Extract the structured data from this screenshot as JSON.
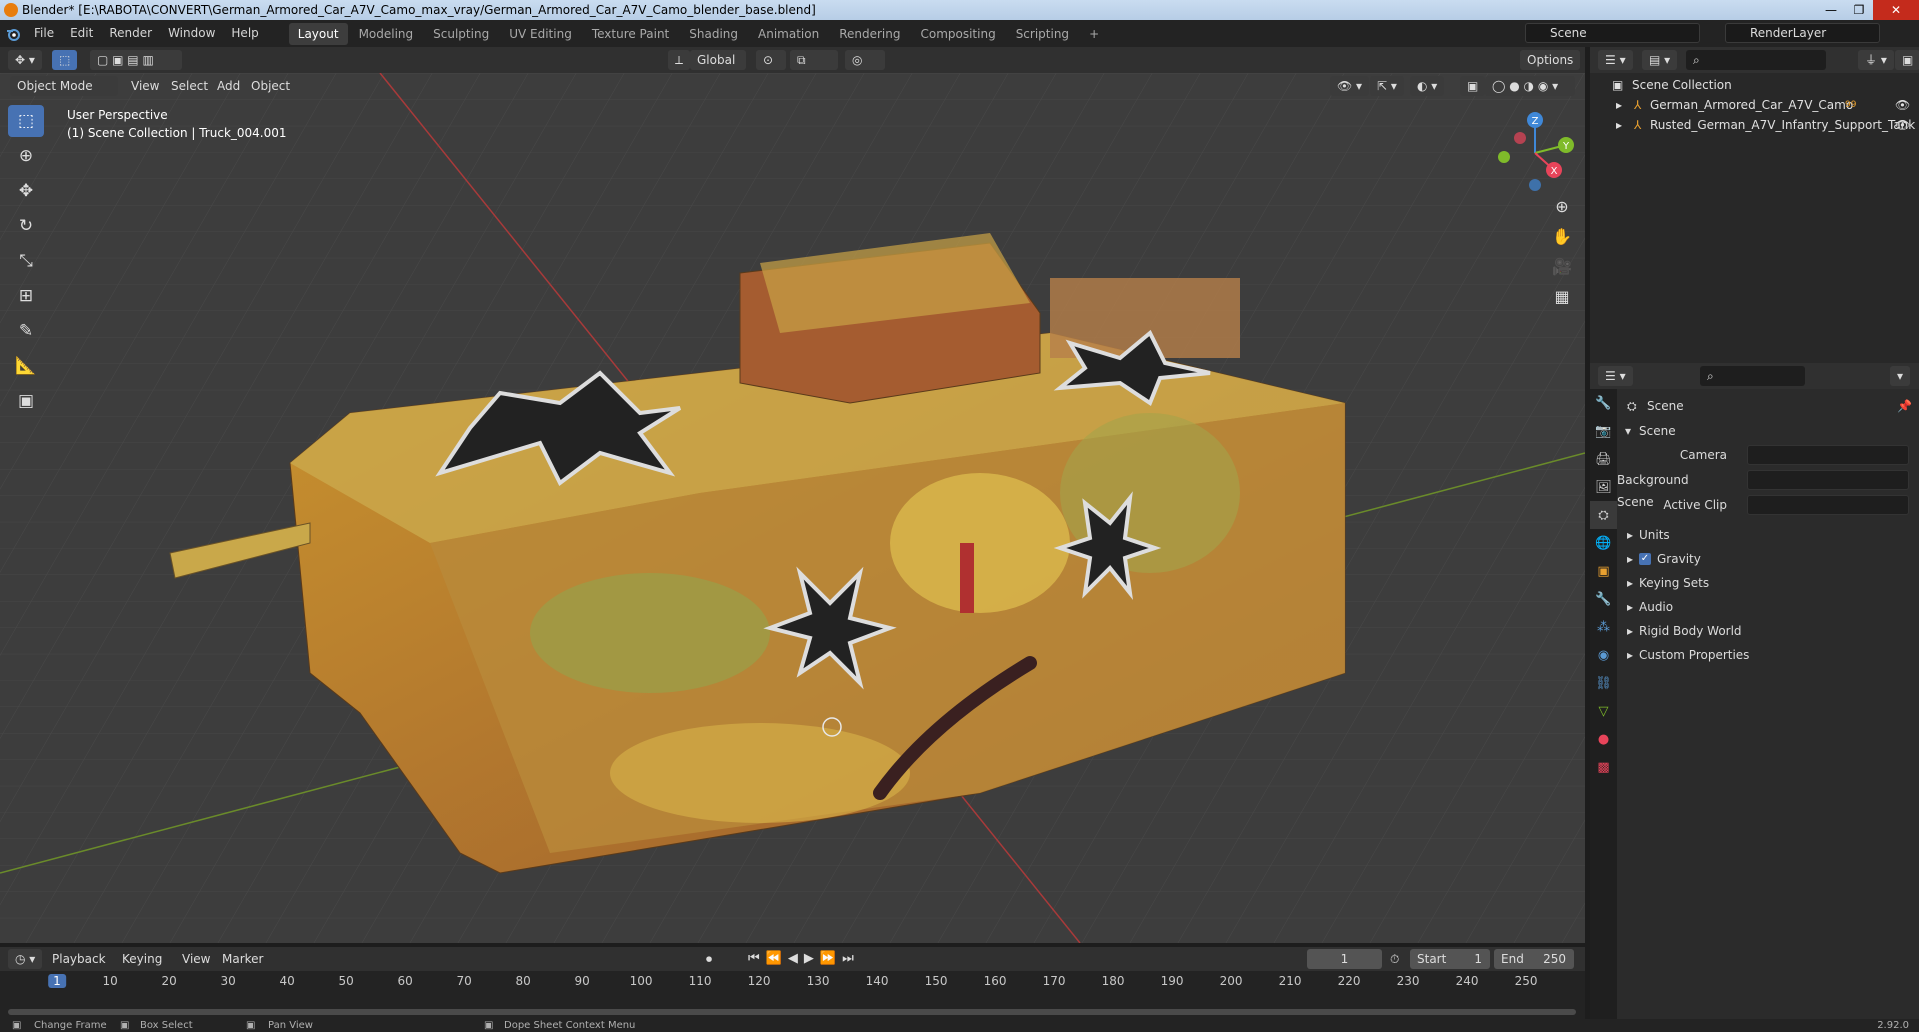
{
  "window": {
    "title": "Blender* [E:\\RABOTA\\CONVERT\\German_Armored_Car_A7V_Camo_max_vray/German_Armored_Car_A7V_Camo_blender_base.blend]",
    "controls": [
      "—",
      "❐",
      "✕"
    ]
  },
  "menu": [
    "File",
    "Edit",
    "Render",
    "Window",
    "Help"
  ],
  "workspaces": [
    "Layout",
    "Modeling",
    "Sculpting",
    "UV Editing",
    "Texture Paint",
    "Shading",
    "Animation",
    "Rendering",
    "Compositing",
    "Scripting"
  ],
  "workspace_add": "+",
  "scene_selector": "Scene",
  "view_layer": "RenderLayer",
  "viewport_header": {
    "transform_orientation": "Global",
    "options": "Options",
    "mode": "Object Mode",
    "menus": [
      "View",
      "Select",
      "Add",
      "Object"
    ]
  },
  "viewport": {
    "perspective": "User Perspective",
    "collection_info": "(1) Scene Collection | Truck_004.001",
    "gizmo": {
      "x": "X",
      "y": "Y",
      "z": "Z"
    },
    "colors": {
      "x_axis": "#e8445a",
      "y_axis": "#7fbb2a",
      "z_axis": "#3f88d8",
      "background": "#3d3d3d"
    }
  },
  "outliner": {
    "root": "Scene Collection",
    "items": [
      {
        "name": "German_Armored_Car_A7V_Camo",
        "badge": "99"
      },
      {
        "name": "Rusted_German_A7V_Infantry_Support_Tank",
        "badge": ""
      }
    ]
  },
  "properties": {
    "context": "Scene",
    "panel": "Scene",
    "fields": [
      {
        "label": "Camera",
        "value": ""
      },
      {
        "label": "Background Scene",
        "value": ""
      },
      {
        "label": "Active Clip",
        "value": ""
      }
    ],
    "subpanels": [
      {
        "label": "Units",
        "checkbox": false
      },
      {
        "label": "Gravity",
        "checkbox": true
      },
      {
        "label": "Keying Sets",
        "checkbox": false
      },
      {
        "label": "Audio",
        "checkbox": false
      },
      {
        "label": "Rigid Body World",
        "checkbox": false
      },
      {
        "label": "Custom Properties",
        "checkbox": false
      }
    ]
  },
  "timeline": {
    "menus": [
      "Playback",
      "Keying",
      "View",
      "Marker"
    ],
    "current_frame": "1",
    "start_label": "Start",
    "start": "1",
    "end_label": "End",
    "end": "250",
    "ticks": [
      "1",
      "10",
      "20",
      "30",
      "40",
      "50",
      "60",
      "70",
      "80",
      "90",
      "100",
      "110",
      "120",
      "130",
      "140",
      "150",
      "160",
      "170",
      "180",
      "190",
      "200",
      "210",
      "220",
      "230",
      "240",
      "250"
    ]
  },
  "statusbar": {
    "items": [
      "Change Frame",
      "Box Select",
      "Pan View",
      "Dope Sheet Context Menu"
    ],
    "version": "2.92.0"
  }
}
